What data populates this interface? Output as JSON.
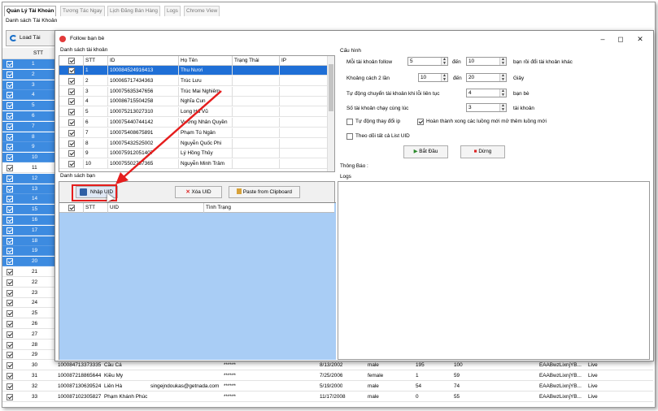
{
  "main": {
    "tabs": [
      "Quản Lý Tài Khoản",
      "Tương Tác Ngay",
      "Lịch Đăng Bán Hàng",
      "Logs",
      "Chrome View"
    ],
    "subtitle": "Danh sách Tài Khoản",
    "load_button": "Load Tài Khoản",
    "stt_header": "STT",
    "rows": [
      {
        "stt": "1",
        "sel": true
      },
      {
        "stt": "2",
        "sel": true
      },
      {
        "stt": "3",
        "sel": true
      },
      {
        "stt": "4",
        "sel": true
      },
      {
        "stt": "5",
        "sel": true
      },
      {
        "stt": "6",
        "sel": true
      },
      {
        "stt": "7",
        "sel": true
      },
      {
        "stt": "8",
        "sel": true
      },
      {
        "stt": "9",
        "sel": true
      },
      {
        "stt": "10",
        "sel": true
      },
      {
        "stt": "11",
        "sel": false
      },
      {
        "stt": "12",
        "sel": true
      },
      {
        "stt": "13",
        "sel": true
      },
      {
        "stt": "14",
        "sel": true
      },
      {
        "stt": "15",
        "sel": true
      },
      {
        "stt": "16",
        "sel": true
      },
      {
        "stt": "17",
        "sel": true
      },
      {
        "stt": "18",
        "sel": true
      },
      {
        "stt": "19",
        "sel": true
      },
      {
        "stt": "20",
        "sel": true
      },
      {
        "stt": "21",
        "sel": false
      },
      {
        "stt": "22",
        "sel": false
      },
      {
        "stt": "23",
        "sel": false
      },
      {
        "stt": "24",
        "sel": false
      },
      {
        "stt": "25",
        "sel": false
      },
      {
        "stt": "26",
        "sel": false
      },
      {
        "stt": "27",
        "sel": false
      },
      {
        "stt": "28",
        "sel": false
      },
      {
        "stt": "29",
        "sel": false
      },
      {
        "stt": "30",
        "sel": false,
        "id": "100084713373335",
        "name": "Cầu Cá",
        "email": "",
        "pass": "******",
        "date": "8/13/2002",
        "gender": "male",
        "a": "195",
        "b": "100",
        "token": "EAABwzLixnjYB...",
        "status": "Live"
      },
      {
        "stt": "31",
        "sel": false,
        "id": "100087218865644",
        "name": "Kiều My",
        "email": "",
        "pass": "******",
        "date": "7/25/2006",
        "gender": "female",
        "a": "1",
        "b": "59",
        "token": "EAABwzLixnjYB...",
        "status": "Live"
      },
      {
        "stt": "32",
        "sel": false,
        "id": "100087130639524",
        "name": "Liên Hà",
        "email": "singejndoukas@getnada.com",
        "pass": "******",
        "date": "5/19/2000",
        "gender": "male",
        "a": "54",
        "b": "74",
        "token": "EAABwzLixnjYB...",
        "status": "Live"
      },
      {
        "stt": "33",
        "sel": false,
        "id": "100087102305827",
        "name": "Phạm Khánh Phúc",
        "email": "",
        "pass": "******",
        "date": "11/17/2008",
        "gender": "male",
        "a": "0",
        "b": "55",
        "token": "EAABwzLixnjYB...",
        "status": "Live"
      }
    ]
  },
  "dialog": {
    "title": "Follow bạn bè",
    "accounts_label": "Danh sách tài khoản",
    "columns": [
      "STT",
      "ID",
      "Họ Tên",
      "Trạng Thái",
      "IP"
    ],
    "accounts": [
      {
        "stt": "1",
        "id": "100084524916413",
        "name": "Thu Nươi"
      },
      {
        "stt": "2",
        "id": "100065717434363",
        "name": "Trúc Lưu"
      },
      {
        "stt": "3",
        "id": "100075635347656",
        "name": "Trúc Mai Nghiêm"
      },
      {
        "stt": "4",
        "id": "100086715504258",
        "name": "Nghĩa Cun"
      },
      {
        "stt": "5",
        "id": "100075213027310",
        "name": "Long Hà Vũ"
      },
      {
        "stt": "6",
        "id": "100075440744142",
        "name": "Vương Nhân Quyền"
      },
      {
        "stt": "7",
        "id": "100075408675891",
        "name": "Phạm Tú Ngân"
      },
      {
        "stt": "8",
        "id": "100075432525002",
        "name": "Nguyễn Quốc Phi"
      },
      {
        "stt": "9",
        "id": "100075912051407",
        "name": "Lý Hồng Thủy"
      },
      {
        "stt": "10",
        "id": "100075502787365",
        "name": "Nguyễn Minh Trâm"
      }
    ],
    "friends_label": "Danh sách bạn",
    "import_button": "Nhập UID",
    "delete_button": "Xóa UID",
    "paste_button": "Paste from Clipboard",
    "uid_columns": [
      "STT",
      "UID",
      "Tình Trạng"
    ],
    "config": {
      "title": "Cấu hình",
      "follow_label": "Mỗi tài khoản follow",
      "follow_from": "5",
      "to_label": "đến",
      "follow_to": "10",
      "follow_suffix": "bạn rồi đổi tài khoản khác",
      "gap_label": "Khoảng cách 2 lần",
      "gap_from": "10",
      "gap_to": "20",
      "gap_suffix": "Giây",
      "auto_switch_label": "Tự động chuyển tài khoản khi lỗi liên tục",
      "auto_switch_value": "4",
      "auto_switch_suffix": "bạn bè",
      "concurrent_label": "Số tài khoản chạy cùng lúc",
      "concurrent_value": "3",
      "concurrent_suffix": "tài khoản",
      "chk_ip": "Tự động thay đổi ip",
      "chk_new_thread": "Hoàn thành xong các luồng mới mở thêm luồng mới",
      "chk_all_uid": "Theo dõi  tất cả List UID",
      "start_button": "Bắt Đầu",
      "stop_button": "Dừng",
      "notice_label": "Thông Báo :"
    },
    "logs_label": "Logs"
  },
  "colors": {
    "selection": "#3d8be0",
    "dialog_selection": "#1f6fd6",
    "uid_area": "#a9cdf5",
    "highlight": "#e51d1d"
  }
}
